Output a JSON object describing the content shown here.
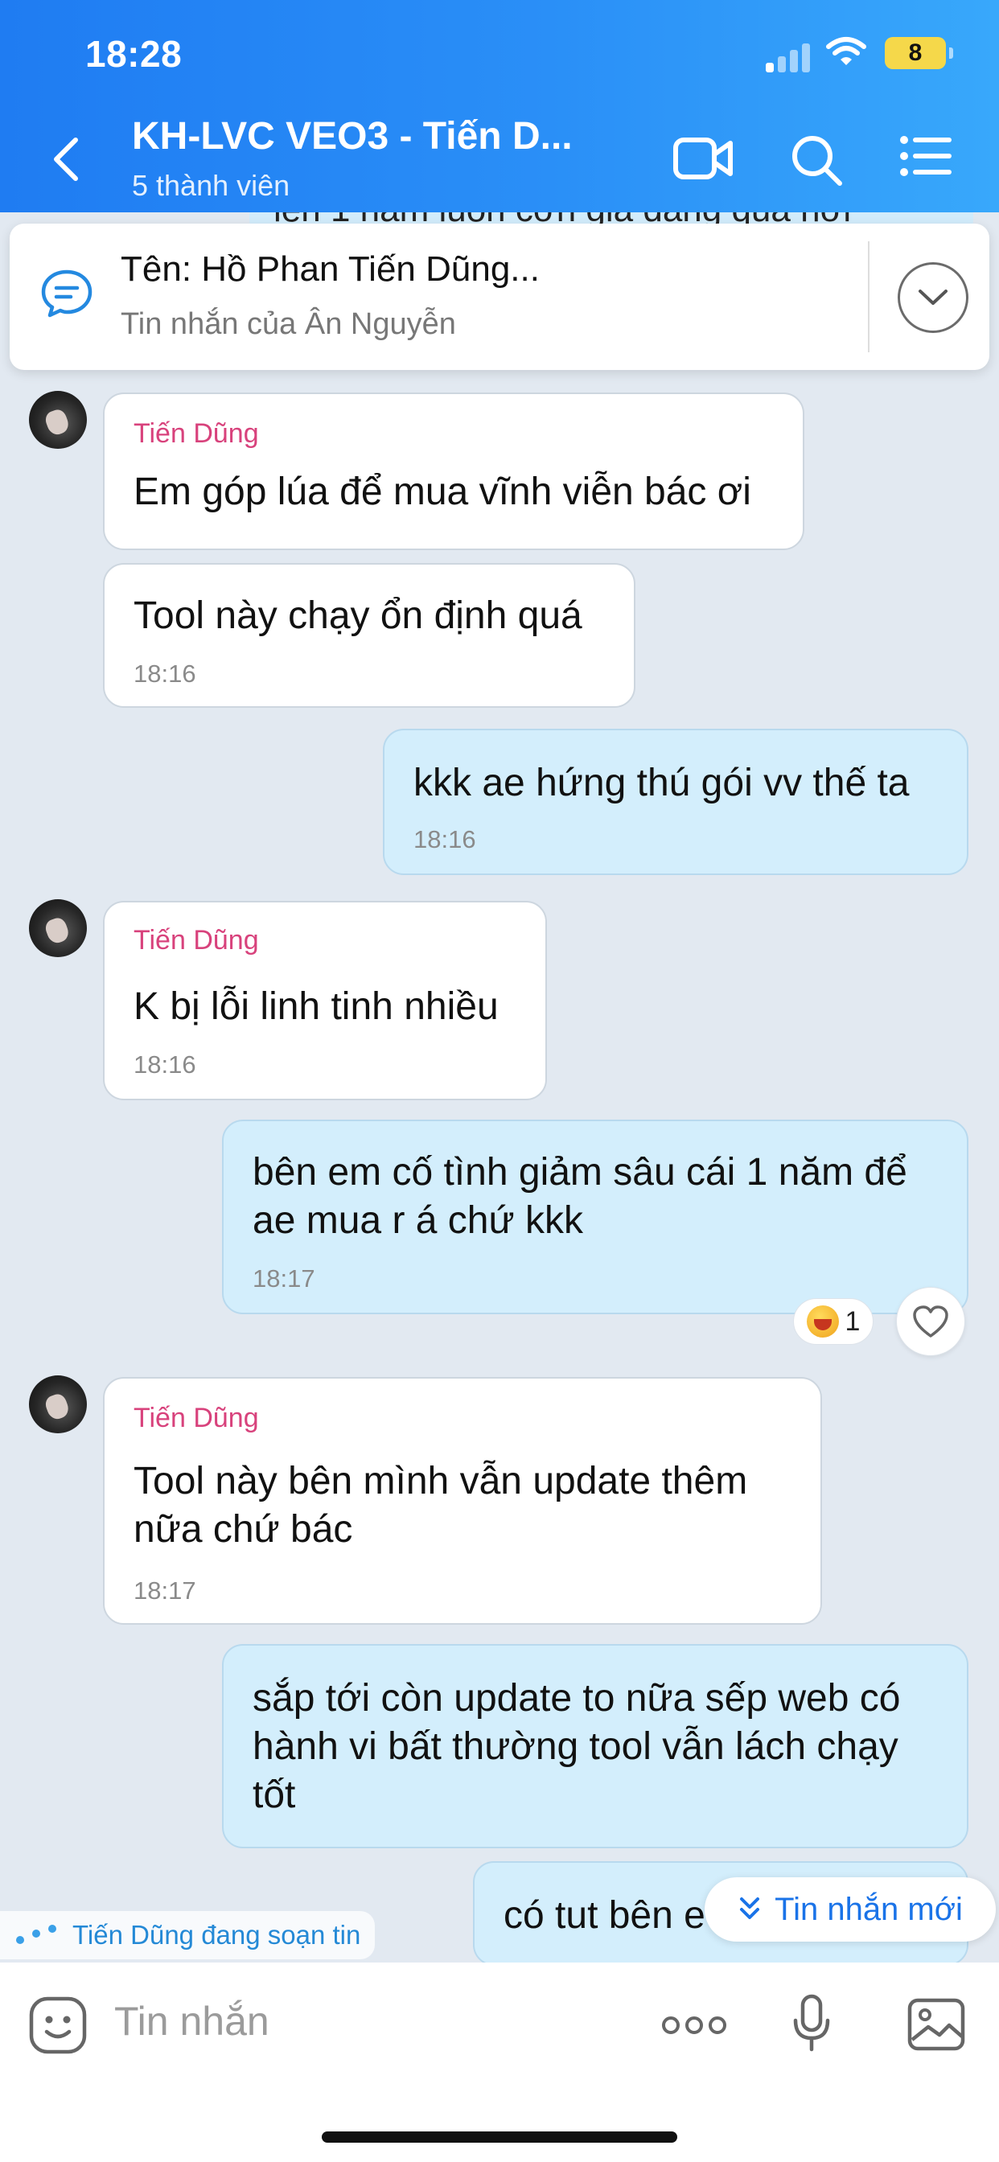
{
  "status_bar": {
    "time": "18:28",
    "battery": "8"
  },
  "header": {
    "title": "KH-LVC VEO3 - Tiến D...",
    "subtitle": "5 thành viên"
  },
  "pinned": {
    "peek_text": "lên 1 năm luôn cơn giá đang quá hời",
    "title": "Tên: Hồ Phan Tiến Dũng...",
    "subtitle": "Tin nhắn của Ân Nguyễn"
  },
  "messages": [
    {
      "direction": "in",
      "sender": "Tiến Dũng",
      "text": "Em góp lúa để mua vĩnh viễn bác ơi",
      "time": ""
    },
    {
      "direction": "in",
      "sender": "",
      "text": "Tool này chạy ổn định quá",
      "time": "18:16"
    },
    {
      "direction": "out",
      "sender": "",
      "text": "kkk ae hứng thú gói vv thế ta",
      "time": "18:16"
    },
    {
      "direction": "in",
      "sender": "Tiến Dũng",
      "text": "K bị lỗi linh tinh nhiều",
      "time": "18:16"
    },
    {
      "direction": "out",
      "sender": "",
      "text": "bên em cố tình giảm sâu cái 1 năm để ae mua r á chứ kkk",
      "time": "18:17"
    },
    {
      "direction": "in",
      "sender": "Tiến Dũng",
      "text": "Tool này bên mình vẫn update thêm nữa chứ bác",
      "time": "18:17"
    },
    {
      "direction": "out",
      "sender": "",
      "text": "sắp tới còn update to nữa sếp web có hành vi bất thường tool vẫn lách chạy tốt",
      "time": ""
    },
    {
      "direction": "out",
      "sender": "",
      "text": "có tut bên e",
      "time": ""
    }
  ],
  "reaction": {
    "count": "1"
  },
  "typing_indicator": "Tiến Dũng đang soạn tin",
  "new_messages_button": "Tin nhắn mới",
  "composer": {
    "placeholder": "Tin nhắn"
  }
}
